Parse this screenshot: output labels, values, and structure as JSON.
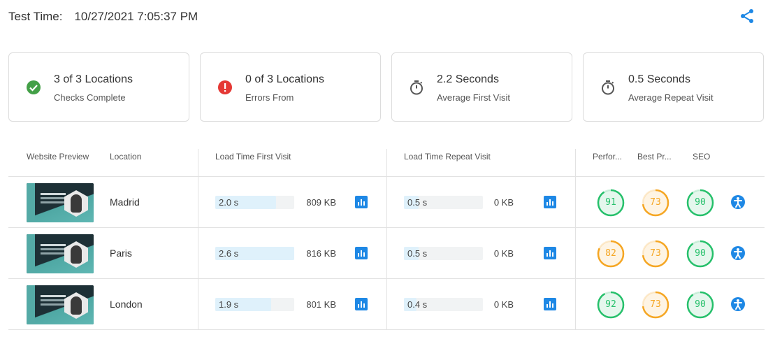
{
  "header": {
    "label": "Test Time:",
    "value": "10/27/2021 7:05:37 PM",
    "share_icon": "share-icon"
  },
  "cards": [
    {
      "title": "3 of 3 Locations",
      "sub": "Checks Complete",
      "icon": "check-circle-icon",
      "color": "#43a047"
    },
    {
      "title": "0 of 3 Locations",
      "sub": "Errors From",
      "icon": "error-circle-icon",
      "color": "#e53935"
    },
    {
      "title": "2.2 Seconds",
      "sub": "Average First Visit",
      "icon": "stopwatch-icon",
      "color": "#555555"
    },
    {
      "title": "0.5 Seconds",
      "sub": "Average Repeat Visit",
      "icon": "stopwatch-icon",
      "color": "#555555"
    }
  ],
  "table": {
    "headers": {
      "preview": "Website Preview",
      "location": "Location",
      "first": "Load Time First Visit",
      "repeat": "Load Time Repeat Visit",
      "perf": "Perfor...",
      "best": "Best Pr...",
      "seo": "SEO"
    },
    "rows": [
      {
        "location": "Madrid",
        "first_time": "2.0 s",
        "first_fill": 0.77,
        "first_kb": "809 KB",
        "repeat_time": "0.5 s",
        "repeat_fill": 0.19,
        "repeat_kb": "0 KB",
        "perf": "91",
        "best": "73",
        "seo": "90"
      },
      {
        "location": "Paris",
        "first_time": "2.6 s",
        "first_fill": 1.0,
        "first_kb": "816 KB",
        "repeat_time": "0.5 s",
        "repeat_fill": 0.19,
        "repeat_kb": "0 KB",
        "perf": "82",
        "best": "73",
        "seo": "90"
      },
      {
        "location": "London",
        "first_time": "1.9 s",
        "first_fill": 0.71,
        "first_kb": "801 KB",
        "repeat_time": "0.4 s",
        "repeat_fill": 0.16,
        "repeat_kb": "0 KB",
        "perf": "92",
        "best": "73",
        "seo": "90"
      }
    ]
  },
  "colors": {
    "accent": "#1e88e5",
    "good": "#26c06b",
    "average": "#f5a623",
    "bar_fill": "#dff1fb",
    "bar_track": "#f1f3f4"
  }
}
